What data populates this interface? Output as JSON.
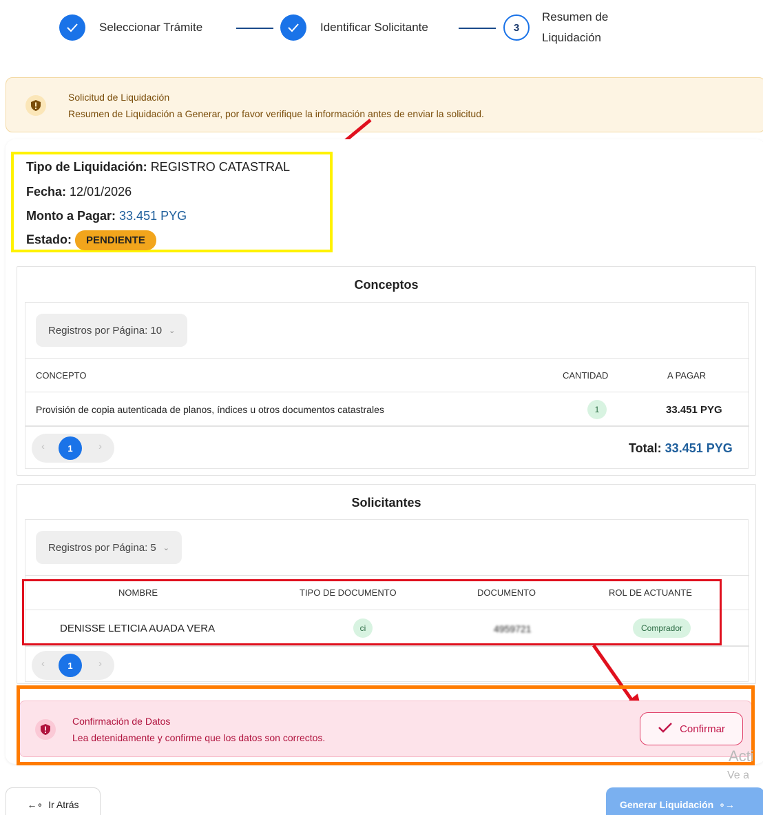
{
  "stepper": {
    "steps": [
      {
        "label": "Seleccionar Trámite",
        "state": "done"
      },
      {
        "label": "Identificar Solicitante",
        "state": "done"
      },
      {
        "number": "3",
        "label_line1": "Resumen de",
        "label_line2": "Liquidación",
        "state": "current"
      }
    ]
  },
  "banner": {
    "title": "Solicitud de Liquidación",
    "text": "Resumen de Liquidación a Generar, por favor verifique la información antes de enviar la solicitud.",
    "icon": "shield-alert-icon"
  },
  "summary": {
    "tipo_label": "Tipo de Liquidación:",
    "tipo_value": "REGISTRO CATASTRAL",
    "fecha_label": "Fecha:",
    "fecha_value": "12/01/2026",
    "monto_label": "Monto a Pagar:",
    "monto_value": "33.451 PYG",
    "estado_label": "Estado:",
    "estado_value": "PENDIENTE"
  },
  "conceptos": {
    "title": "Conceptos",
    "per_page_label": "Registros por Página: 10",
    "columns": [
      "CONCEPTO",
      "CANTIDAD",
      "A PAGAR"
    ],
    "rows": [
      {
        "concepto": "Provisión de copia autenticada de planos, índices u otros documentos catastrales",
        "cantidad": "1",
        "a_pagar": "33.451 PYG"
      }
    ],
    "page": "1",
    "total_label": "Total:",
    "total_value": "33.451 PYG"
  },
  "solicitantes": {
    "title": "Solicitantes",
    "per_page_label": "Registros por Página: 5",
    "columns": [
      "NOMBRE",
      "TIPO DE DOCUMENTO",
      "DOCUMENTO",
      "ROL DE ACTUANTE"
    ],
    "rows": [
      {
        "nombre": "DENISSE LETICIA AUADA VERA",
        "tipo": "ci",
        "documento": "4959721",
        "rol": "Comprador"
      }
    ],
    "page": "1"
  },
  "confirmacion": {
    "title": "Confirmación de Datos",
    "text": "Lea detenidamente y confirme que los datos son correctos.",
    "button": "Confirmar"
  },
  "footer": {
    "back_label": "Ir Atrás",
    "generate_label": "Generar Liquidación"
  },
  "watermark": {
    "line1": "Acti",
    "line2": "Ve a"
  },
  "colors": {
    "accent": "#1a73e8",
    "pending": "#f2a51c",
    "annotation_yellow": "#fff200",
    "annotation_red": "#e0101e",
    "annotation_orange": "#ff7b00"
  }
}
